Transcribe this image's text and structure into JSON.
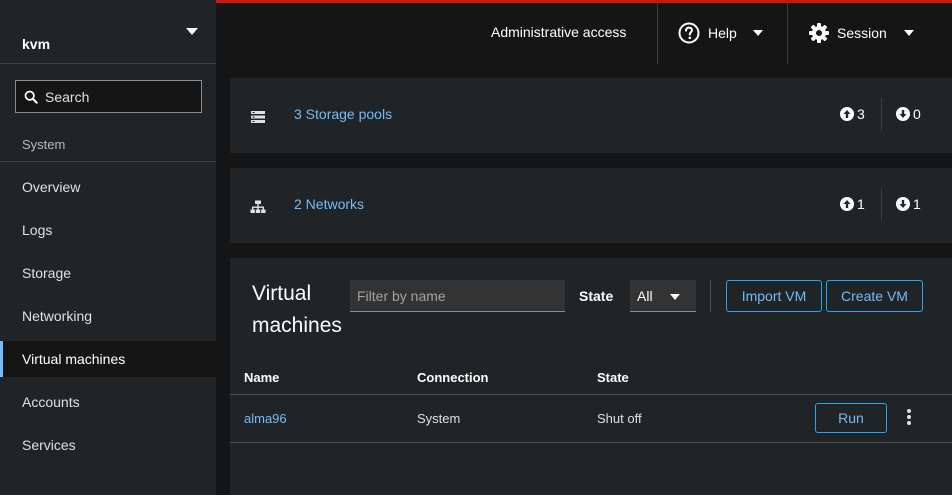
{
  "host": {
    "name": "kvm"
  },
  "search": {
    "placeholder": "Search"
  },
  "sidebar": {
    "section_label": "System",
    "items": [
      {
        "label": "Overview"
      },
      {
        "label": "Logs"
      },
      {
        "label": "Storage"
      },
      {
        "label": "Networking"
      },
      {
        "label": "Virtual machines",
        "active": true
      },
      {
        "label": "Accounts"
      },
      {
        "label": "Services"
      }
    ]
  },
  "topbar": {
    "admin_label": "Administrative access",
    "help_label": "Help",
    "session_label": "Session"
  },
  "storage_card": {
    "link": "3 Storage pools",
    "up": "3",
    "down": "0"
  },
  "networks_card": {
    "link": "2 Networks",
    "up": "1",
    "down": "1"
  },
  "vms": {
    "title": "Virtual machines",
    "filter_placeholder": "Filter by name",
    "state_label": "State",
    "state_value": "All",
    "import_label": "Import VM",
    "create_label": "Create VM",
    "columns": [
      "Name",
      "Connection",
      "State"
    ],
    "rows": [
      {
        "name": "alma96",
        "connection": "System",
        "state": "Shut off",
        "action": "Run"
      }
    ]
  },
  "colors": {
    "accent": "#73bcf7",
    "topline": "#c9190b"
  }
}
